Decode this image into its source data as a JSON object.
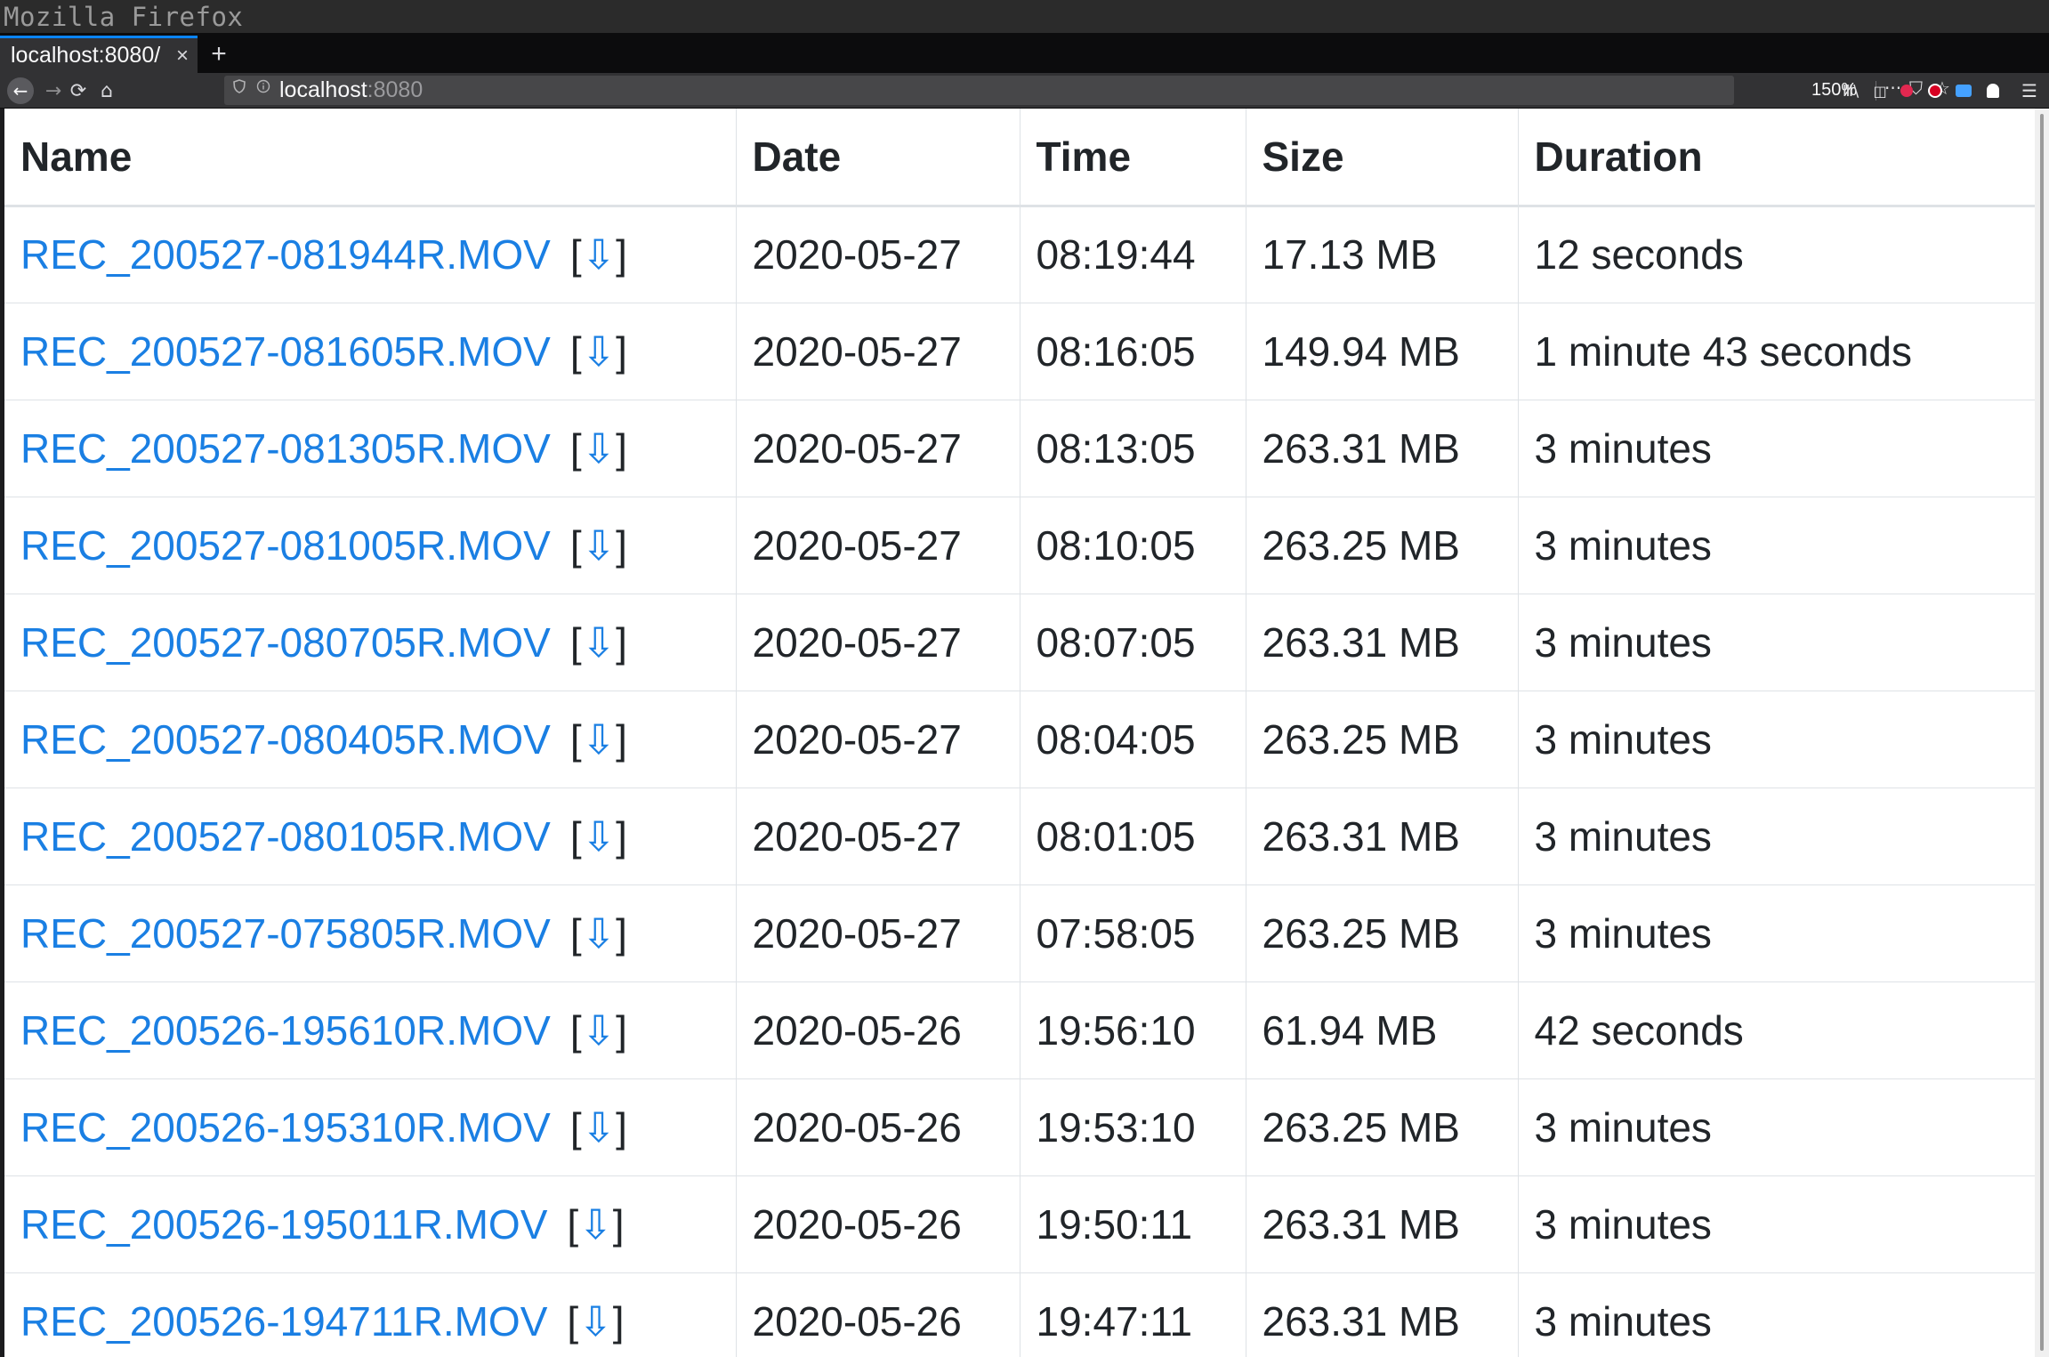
{
  "window": {
    "title": "Mozilla Firefox"
  },
  "tabs": [
    {
      "label": "localhost:8080/",
      "close": "×",
      "active": true
    }
  ],
  "newtab_label": "+",
  "toolbar": {
    "back_icon": "←",
    "forward_icon": "→",
    "reload_icon": "⟳",
    "home_icon": "⌂",
    "url_host": "localhost",
    "url_port": ":8080",
    "zoom": "150%",
    "page_actions_icon": "···",
    "pocket_icon": "⛉",
    "bookmark_icon": "☆",
    "library_icon": "Ⅲ\\",
    "sidebar_icon": "◫",
    "menu_icon": "☰"
  },
  "table": {
    "headers": [
      "Name",
      "Date",
      "Time",
      "Size",
      "Duration"
    ],
    "download_open": "[",
    "download_icon": "⇩",
    "download_close": "]",
    "rows": [
      {
        "name": "REC_200527-081944R.MOV",
        "date": "2020-05-27",
        "time": "08:19:44",
        "size": "17.13 MB",
        "duration": "12 seconds"
      },
      {
        "name": "REC_200527-081605R.MOV",
        "date": "2020-05-27",
        "time": "08:16:05",
        "size": "149.94 MB",
        "duration": "1 minute 43 seconds"
      },
      {
        "name": "REC_200527-081305R.MOV",
        "date": "2020-05-27",
        "time": "08:13:05",
        "size": "263.31 MB",
        "duration": "3 minutes"
      },
      {
        "name": "REC_200527-081005R.MOV",
        "date": "2020-05-27",
        "time": "08:10:05",
        "size": "263.25 MB",
        "duration": "3 minutes"
      },
      {
        "name": "REC_200527-080705R.MOV",
        "date": "2020-05-27",
        "time": "08:07:05",
        "size": "263.31 MB",
        "duration": "3 minutes"
      },
      {
        "name": "REC_200527-080405R.MOV",
        "date": "2020-05-27",
        "time": "08:04:05",
        "size": "263.25 MB",
        "duration": "3 minutes"
      },
      {
        "name": "REC_200527-080105R.MOV",
        "date": "2020-05-27",
        "time": "08:01:05",
        "size": "263.31 MB",
        "duration": "3 minutes"
      },
      {
        "name": "REC_200527-075805R.MOV",
        "date": "2020-05-27",
        "time": "07:58:05",
        "size": "263.25 MB",
        "duration": "3 minutes"
      },
      {
        "name": "REC_200526-195610R.MOV",
        "date": "2020-05-26",
        "time": "19:56:10",
        "size": "61.94 MB",
        "duration": "42 seconds"
      },
      {
        "name": "REC_200526-195310R.MOV",
        "date": "2020-05-26",
        "time": "19:53:10",
        "size": "263.25 MB",
        "duration": "3 minutes"
      },
      {
        "name": "REC_200526-195011R.MOV",
        "date": "2020-05-26",
        "time": "19:50:11",
        "size": "263.31 MB",
        "duration": "3 minutes"
      },
      {
        "name": "REC_200526-194711R.MOV",
        "date": "2020-05-26",
        "time": "19:47:11",
        "size": "263.31 MB",
        "duration": "3 minutes"
      }
    ]
  },
  "colors": {
    "link": "#1a7fe3",
    "tab_accent": "#0a84ff"
  }
}
